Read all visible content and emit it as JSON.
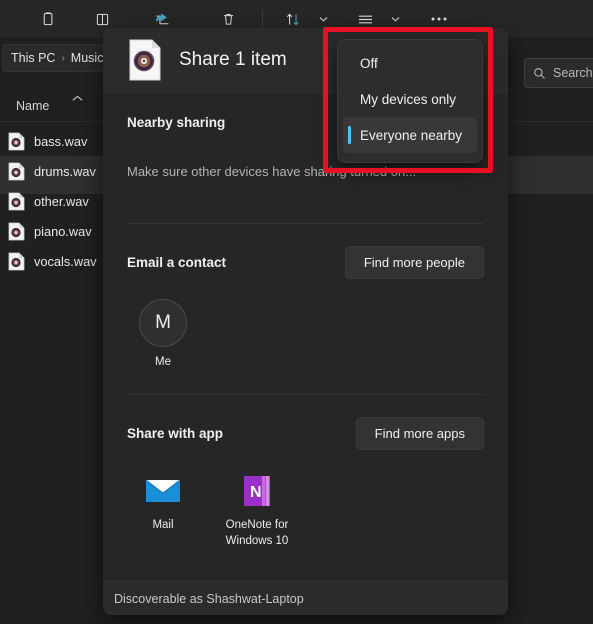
{
  "explorer": {
    "toolbar": {
      "items": [
        {
          "name": "copy-icon",
          "label": "Copy"
        },
        {
          "name": "paste-icon",
          "label": "Paste"
        },
        {
          "name": "share-icon",
          "label": "Share"
        },
        {
          "name": "delete-icon",
          "label": "Delete"
        },
        {
          "name": "sort-icon",
          "label": "Sort"
        },
        {
          "name": "view-icon",
          "label": "View"
        },
        {
          "name": "more-options-icon",
          "label": "See more"
        }
      ]
    },
    "breadcrumb": {
      "root": "This PC",
      "separator": "›",
      "current": "Music"
    },
    "search": {
      "placeholder": "Search",
      "value": "Search",
      "icon": "search-icon"
    },
    "columns": {
      "name": "Name",
      "sort_indicator": "▲"
    },
    "files": [
      {
        "name": "bass.wav",
        "selected": false
      },
      {
        "name": "drums.wav",
        "selected": true
      },
      {
        "name": "other.wav",
        "selected": false
      },
      {
        "name": "piano.wav",
        "selected": false
      },
      {
        "name": "vocals.wav",
        "selected": false
      }
    ]
  },
  "share_dialog": {
    "title": "Share 1 item",
    "file_icon": "wav-file-icon",
    "nearby_sharing": {
      "title": "Nearby sharing",
      "note": "Make sure other devices have sharing turned on...",
      "selected_option": "Everyone nearby",
      "options": [
        "Off",
        "My devices only",
        "Everyone nearby"
      ]
    },
    "email_contact": {
      "title": "Email a contact",
      "action_label": "Find more people",
      "contacts": [
        {
          "initial": "M",
          "label": "Me"
        }
      ]
    },
    "share_with_app": {
      "title": "Share with app",
      "action_label": "Find more apps",
      "apps": [
        {
          "name": "Mail",
          "icon": "mail-app-icon"
        },
        {
          "name": "OneNote for Windows 10",
          "icon": "onenote-app-icon"
        }
      ]
    },
    "status": "Discoverable as Shashwat-Laptop"
  },
  "highlight": {
    "color": "#e81123",
    "target": "nearby-sharing-dropdown"
  }
}
